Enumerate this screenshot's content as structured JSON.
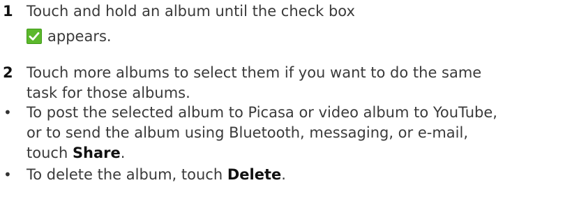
{
  "steps": [
    {
      "marker": "1",
      "line1": "Touch and hold an album until the check box",
      "line2": "appears.",
      "icon": "green-checkbox-icon"
    },
    {
      "marker": "2",
      "line1": "Touch more albums to select them if you want to do the same",
      "line2": "task for those albums."
    }
  ],
  "bullets": [
    {
      "marker": "•",
      "line1": "To post the selected album to Picasa or video album to YouTube,",
      "line2": "or to send the album using Bluetooth, messaging, or e-mail,",
      "line3_prefix": "touch ",
      "keyword": "Share",
      "line3_suffix": "."
    },
    {
      "marker": "•",
      "prefix": "To delete the album, touch ",
      "keyword": "Delete",
      "suffix": "."
    }
  ],
  "colors": {
    "checkbox_green": "#5cb82c",
    "text": "#3a3a3a"
  }
}
